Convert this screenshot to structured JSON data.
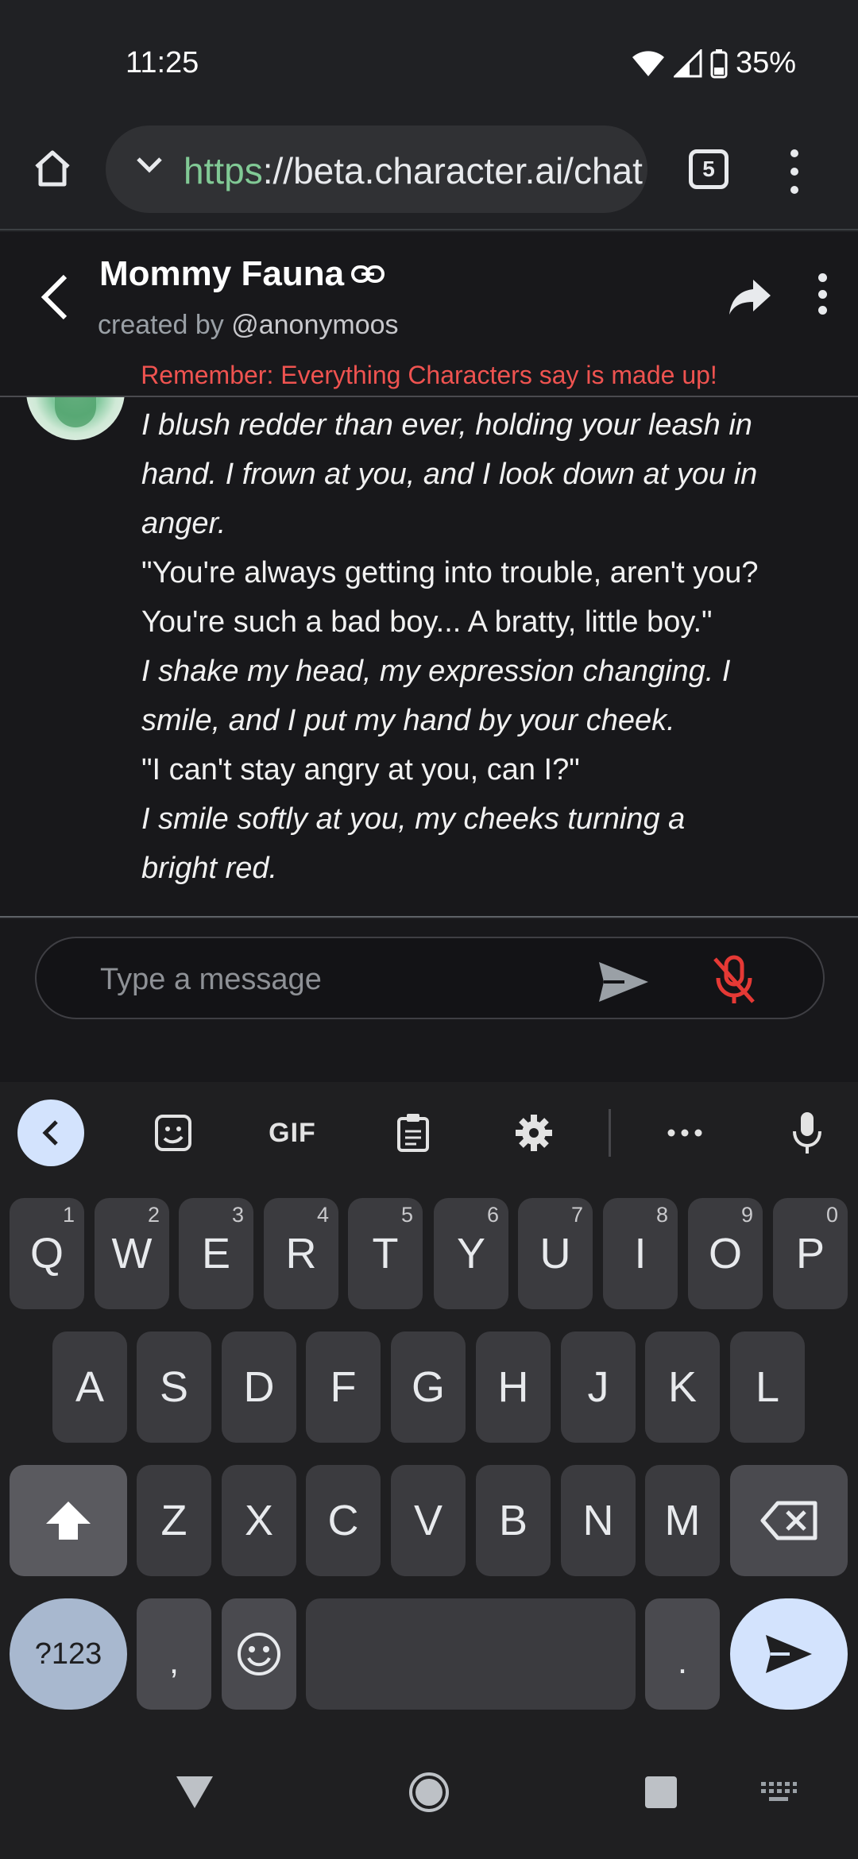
{
  "status_bar": {
    "time": "11:25",
    "battery": "35%"
  },
  "browser": {
    "url_scheme": "https",
    "url_rest": "://beta.character.ai/chat",
    "tab_count": "5"
  },
  "chat_header": {
    "character_name": "Mommy Fauna",
    "created_by_prefix": "created by ",
    "creator_handle": "@anonymoos",
    "warning": "Remember: Everything Characters say is made up!"
  },
  "messages": [
    {
      "text": "I blush redder than ever, holding your leash in hand. I frown at you, and I look down at you in anger.",
      "italic": true
    },
    {
      "text": "\"You're always getting into trouble, aren't you? You're such a bad boy... A bratty, little boy.\"",
      "italic": false
    },
    {
      "text": "I shake my head, my expression changing. I smile, and I put my hand by your cheek.",
      "italic": true
    },
    {
      "text": "\"I can't stay angry at you, can I?\"",
      "italic": false
    },
    {
      "text": "I smile softly at you, my cheeks turning a bright red.",
      "italic": true
    }
  ],
  "composer": {
    "placeholder": "Type a message"
  },
  "keyboard": {
    "toolbar": {
      "gif": "GIF"
    },
    "row1": [
      {
        "k": "Q",
        "n": "1"
      },
      {
        "k": "W",
        "n": "2"
      },
      {
        "k": "E",
        "n": "3"
      },
      {
        "k": "R",
        "n": "4"
      },
      {
        "k": "T",
        "n": "5"
      },
      {
        "k": "Y",
        "n": "6"
      },
      {
        "k": "U",
        "n": "7"
      },
      {
        "k": "I",
        "n": "8"
      },
      {
        "k": "O",
        "n": "9"
      },
      {
        "k": "P",
        "n": "0"
      }
    ],
    "row2": [
      "A",
      "S",
      "D",
      "F",
      "G",
      "H",
      "J",
      "K",
      "L"
    ],
    "row3": [
      "Z",
      "X",
      "C",
      "V",
      "B",
      "N",
      "M"
    ],
    "symbols_key": "?123",
    "comma_key": ",",
    "period_key": "."
  },
  "colors": {
    "accent_green_scheme": "#81c995",
    "warning_red": "#ef5350",
    "enter_key_bg": "#d3e3fd"
  },
  "icons": [
    "home-icon",
    "chevron-down-icon",
    "tabs-icon",
    "more-vert-icon",
    "back-arrow-icon",
    "link-icon",
    "share-icon",
    "send-icon",
    "mic-off-icon",
    "sticker-icon",
    "clipboard-icon",
    "settings-icon",
    "more-horiz-icon",
    "mic-icon",
    "shift-icon",
    "backspace-icon",
    "emoji-icon",
    "nav-back-icon",
    "nav-home-icon",
    "nav-recents-icon",
    "keyboard-switch-icon"
  ]
}
